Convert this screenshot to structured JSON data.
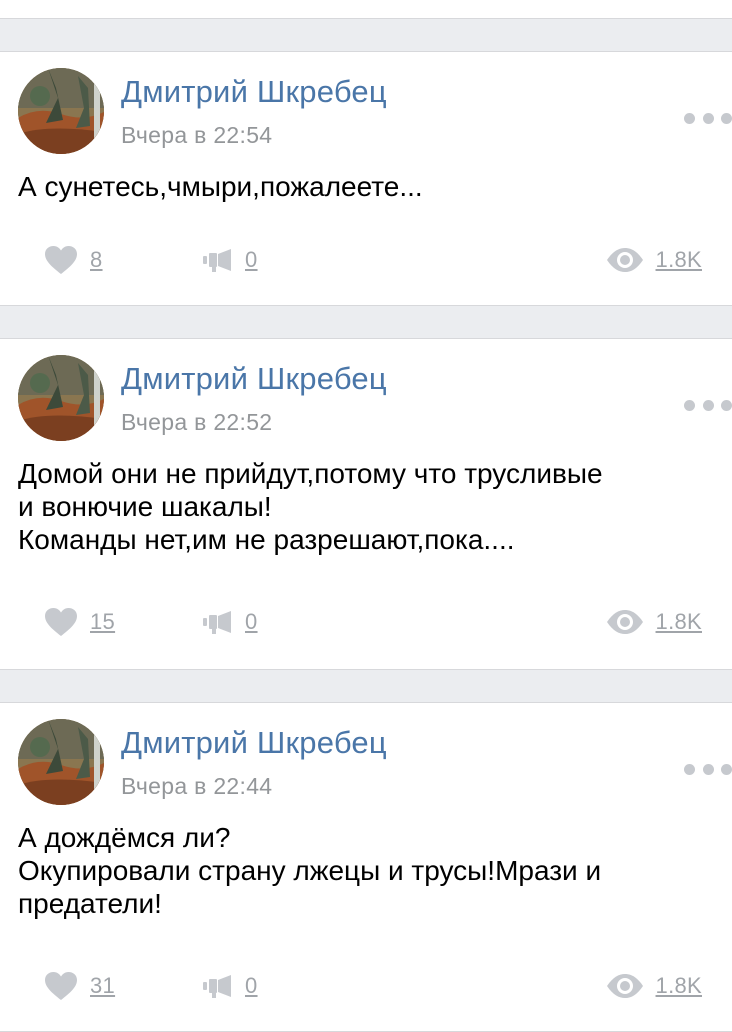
{
  "colors": {
    "author_link": "#4a76a8",
    "meta_gray": "#939699",
    "icon_gray": "#c6c9ce",
    "divider": "#d7d8db",
    "feed_background": "#ebedf0"
  },
  "icons": {
    "like": "heart-icon",
    "share": "megaphone-icon",
    "views": "eye-icon",
    "menu": "more-dots-icon"
  },
  "posts": [
    {
      "author": "Дмитрий Шкребец",
      "time": "Вчера в 22:54",
      "text_lines": [
        "А сунетесь,чмыри,пожалеете..."
      ],
      "likes": "8",
      "shares": "0",
      "views": "1.8K"
    },
    {
      "author": "Дмитрий Шкребец",
      "time": "Вчера в 22:52",
      "text_lines": [
        "Домой они не прийдут,потому что трусливые",
        "и вонючие шакалы!",
        "Команды нет,им не разрешают,пока...."
      ],
      "likes": "15",
      "shares": "0",
      "views": "1.8K"
    },
    {
      "author": "Дмитрий Шкребец",
      "time": "Вчера в 22:44",
      "text_lines": [
        "А дождёмся ли?",
        "Окупировали страну лжецы и трусы!Мрази и",
        "предатели!"
      ],
      "likes": "31",
      "shares": "0",
      "views": "1.8K"
    }
  ]
}
